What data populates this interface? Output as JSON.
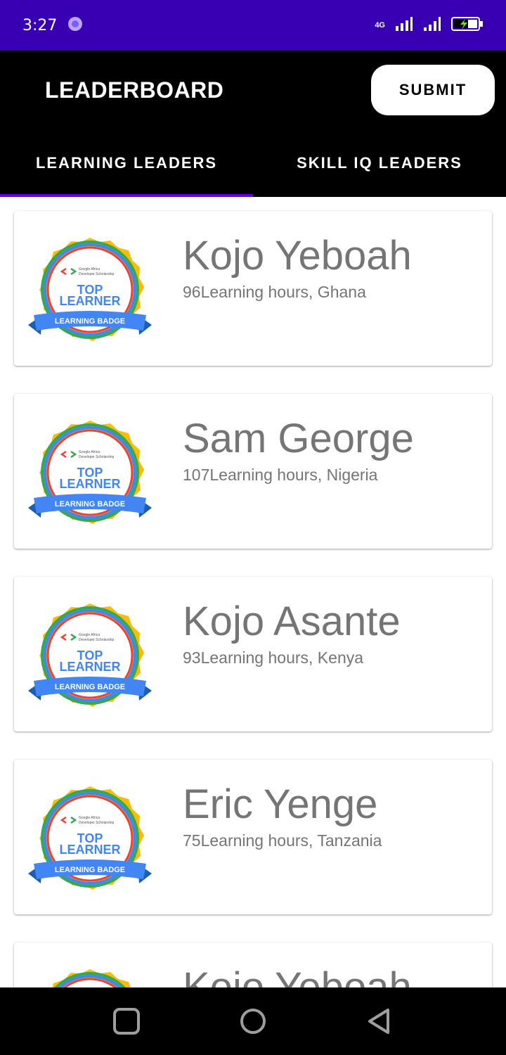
{
  "status_bar": {
    "time": "3:27",
    "network_label": "4G"
  },
  "app_bar": {
    "title": "LEADERBOARD",
    "submit_label": "SUBMIT"
  },
  "tabs": [
    {
      "label": "LEARNING LEADERS",
      "active": true
    },
    {
      "label": "SKILL IQ LEADERS",
      "active": false
    }
  ],
  "badge": {
    "org": "Google Africa",
    "program": "Developer Scholarship",
    "line1": "TOP",
    "line2": "LEARNER",
    "ribbon": "LEARNING BADGE"
  },
  "leaders": [
    {
      "name": "Kojo Yeboah",
      "detail": "96Learning hours, Ghana"
    },
    {
      "name": "Sam George",
      "detail": "107Learning hours, Nigeria"
    },
    {
      "name": "Kojo Asante",
      "detail": "93Learning hours, Kenya"
    },
    {
      "name": "Eric Yenge",
      "detail": "75Learning hours, Tanzania"
    },
    {
      "name": "Kojo Yeboah",
      "detail": ""
    }
  ],
  "colors": {
    "status_bar": "#3700b3",
    "accent": "#6200ee",
    "badge_gold": "#fbbc05",
    "badge_blue": "#4285f4",
    "badge_red": "#ea4335",
    "badge_green": "#34a853"
  }
}
